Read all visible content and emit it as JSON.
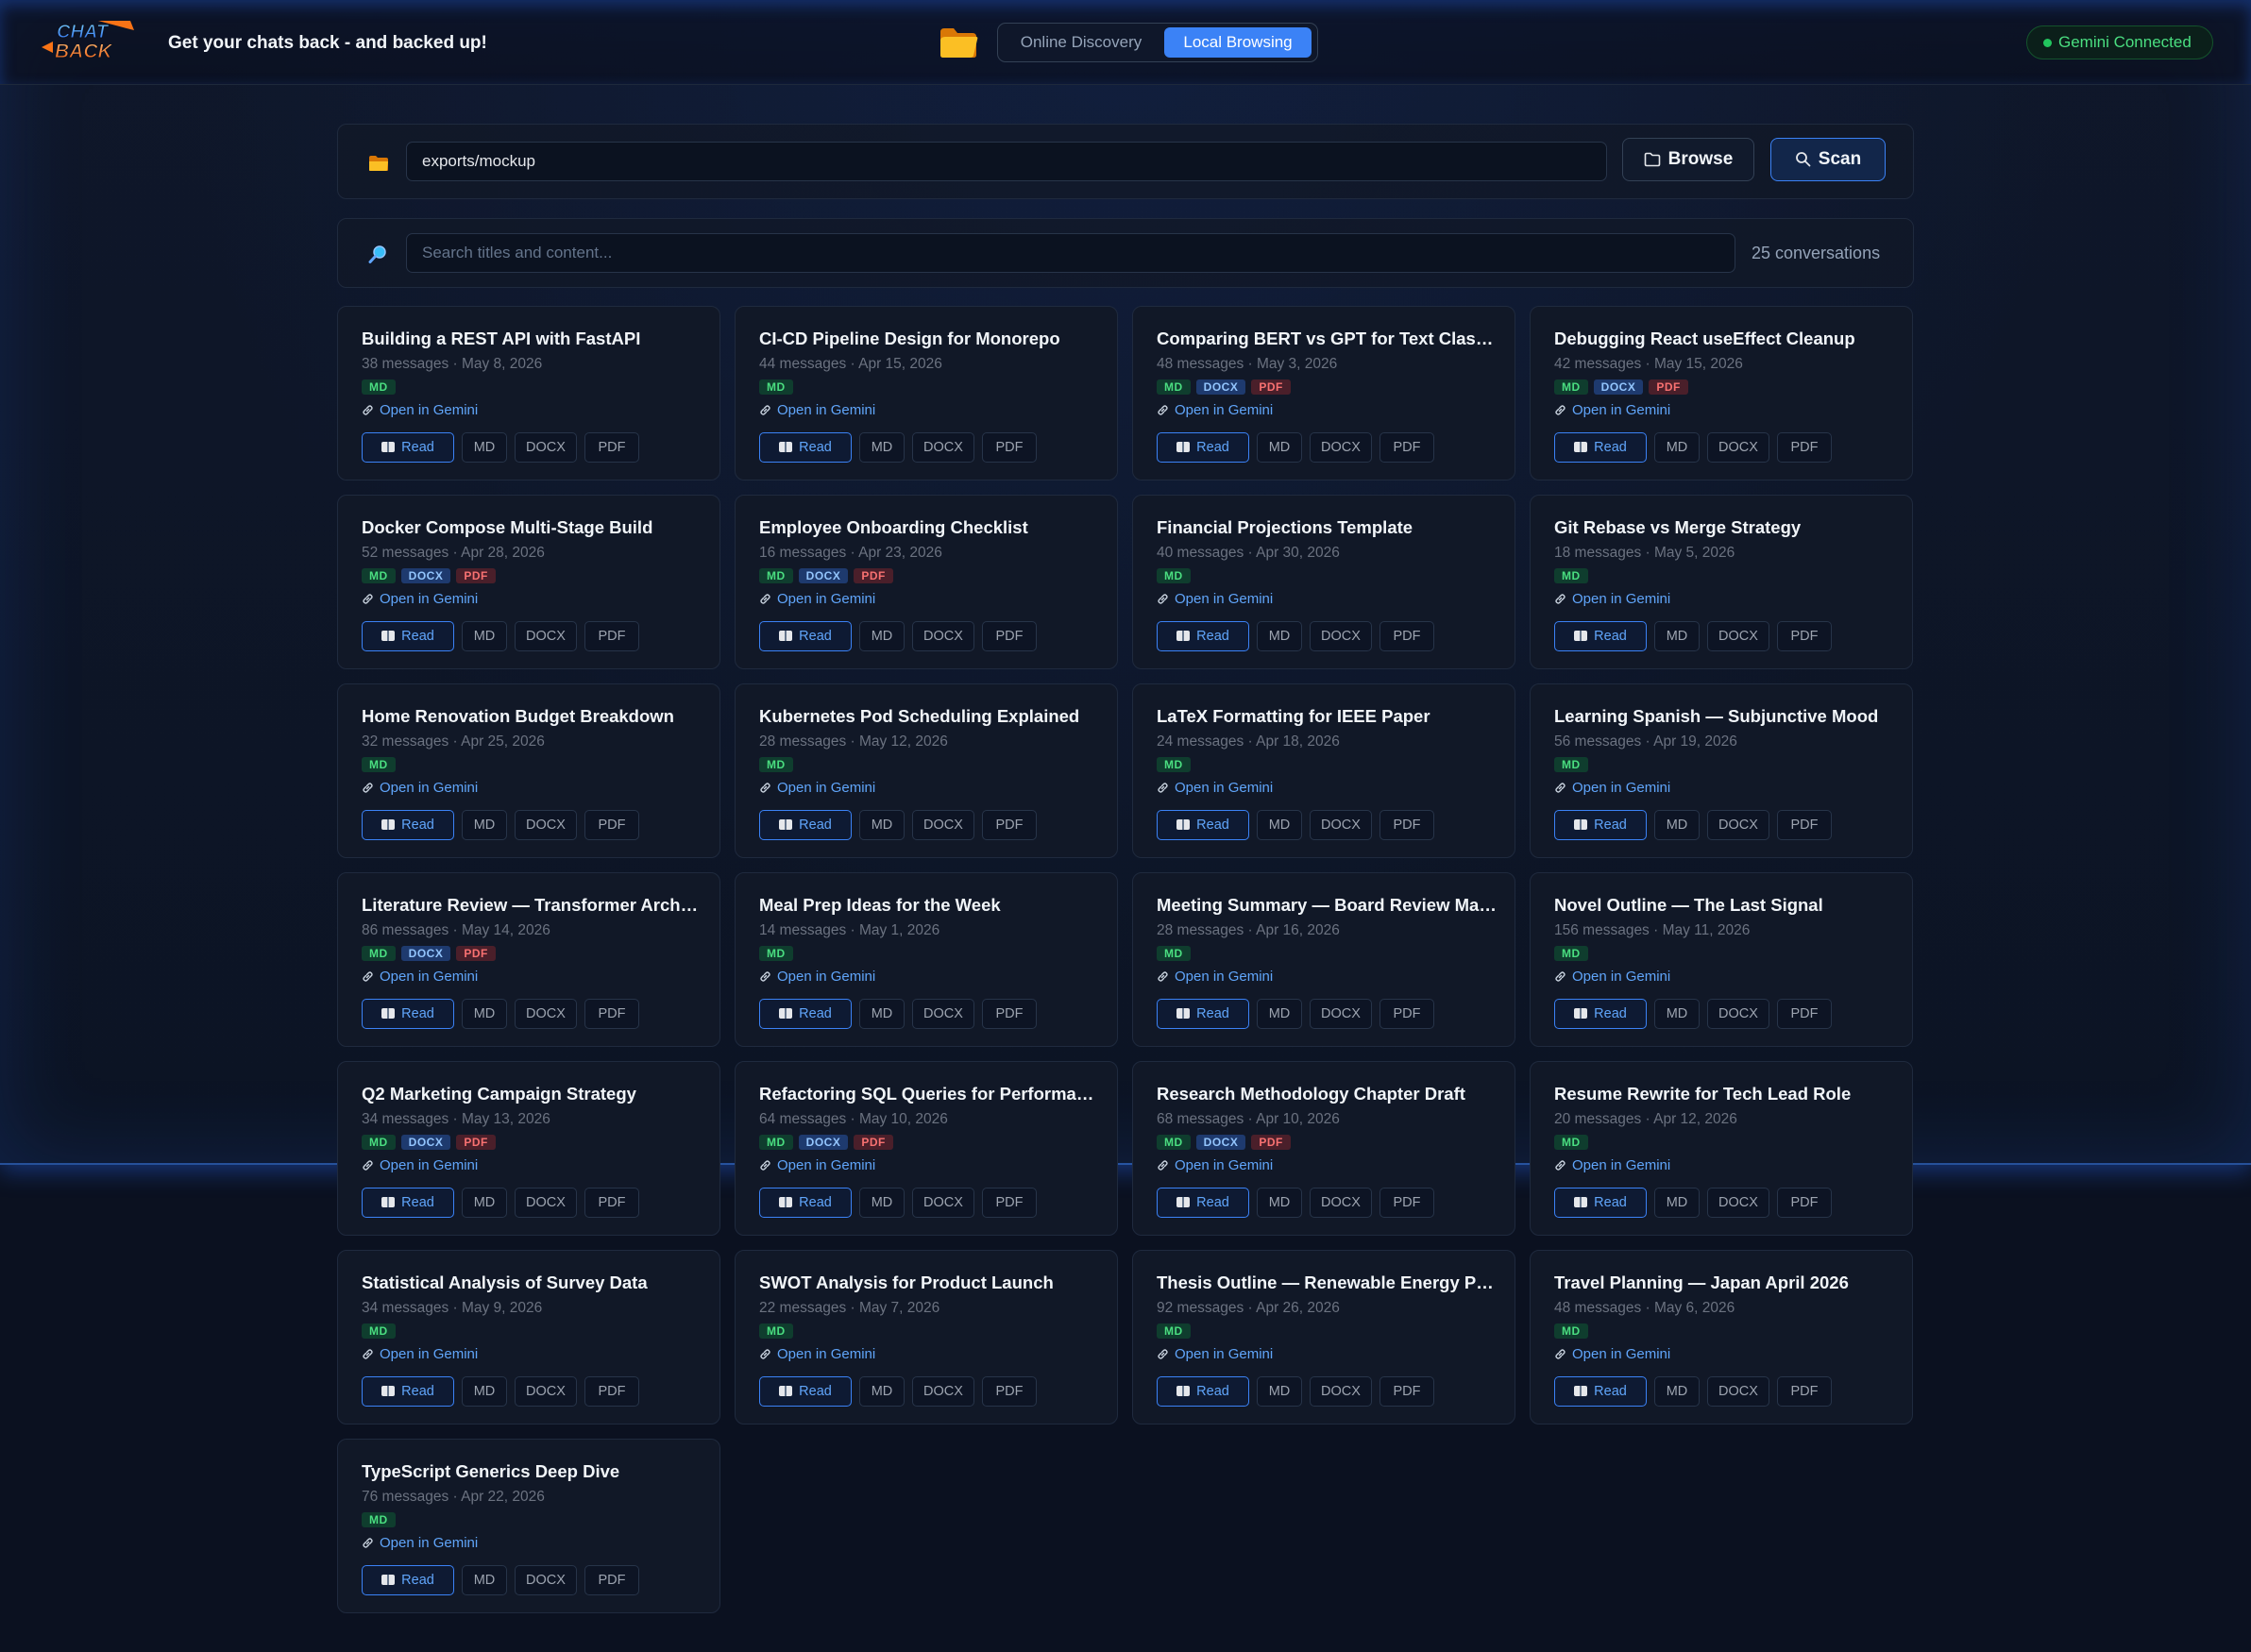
{
  "header": {
    "tagline": "Get your chats back - and backed up!",
    "logo_text": "CHAT BACK",
    "mode_online": "Online Discovery",
    "mode_local": "Local Browsing",
    "status": "Gemini Connected"
  },
  "path": {
    "value": "exports/mockup",
    "browse_label": "Browse",
    "scan_label": "Scan"
  },
  "search": {
    "placeholder": "Search titles and content...",
    "count": "25 conversations"
  },
  "labels": {
    "open": "Open in Gemini",
    "read": "Read",
    "md": "MD",
    "docx": "DOCX",
    "pdf": "PDF"
  },
  "colors": {
    "accent": "#3b82f6",
    "status_green": "#22c55e",
    "badge_md": "#4ade80",
    "badge_docx": "#93c5fd",
    "badge_pdf": "#f87171"
  },
  "conversations": [
    {
      "title": "Building a REST API with FastAPI",
      "meta": "38 messages · May 8, 2026",
      "formats": [
        "MD"
      ]
    },
    {
      "title": "CI-CD Pipeline Design for Monorepo",
      "meta": "44 messages · Apr 15, 2026",
      "formats": [
        "MD"
      ]
    },
    {
      "title": "Comparing BERT vs GPT for Text Classif...",
      "meta": "48 messages · May 3, 2026",
      "formats": [
        "MD",
        "DOCX",
        "PDF"
      ]
    },
    {
      "title": "Debugging React useEffect Cleanup",
      "meta": "42 messages · May 15, 2026",
      "formats": [
        "MD",
        "DOCX",
        "PDF"
      ]
    },
    {
      "title": "Docker Compose Multi-Stage Build",
      "meta": "52 messages · Apr 28, 2026",
      "formats": [
        "MD",
        "DOCX",
        "PDF"
      ]
    },
    {
      "title": "Employee Onboarding Checklist",
      "meta": "16 messages · Apr 23, 2026",
      "formats": [
        "MD",
        "DOCX",
        "PDF"
      ]
    },
    {
      "title": "Financial Projections Template",
      "meta": "40 messages · Apr 30, 2026",
      "formats": [
        "MD"
      ]
    },
    {
      "title": "Git Rebase vs Merge Strategy",
      "meta": "18 messages · May 5, 2026",
      "formats": [
        "MD"
      ]
    },
    {
      "title": "Home Renovation Budget Breakdown",
      "meta": "32 messages · Apr 25, 2026",
      "formats": [
        "MD"
      ]
    },
    {
      "title": "Kubernetes Pod Scheduling Explained",
      "meta": "28 messages · May 12, 2026",
      "formats": [
        "MD"
      ]
    },
    {
      "title": "LaTeX Formatting for IEEE Paper",
      "meta": "24 messages · Apr 18, 2026",
      "formats": [
        "MD"
      ]
    },
    {
      "title": "Learning Spanish — Subjunctive Mood",
      "meta": "56 messages · Apr 19, 2026",
      "formats": [
        "MD"
      ]
    },
    {
      "title": "Literature Review — Transformer Archit...",
      "meta": "86 messages · May 14, 2026",
      "formats": [
        "MD",
        "DOCX",
        "PDF"
      ]
    },
    {
      "title": "Meal Prep Ideas for the Week",
      "meta": "14 messages · May 1, 2026",
      "formats": [
        "MD"
      ]
    },
    {
      "title": "Meeting Summary — Board Review March",
      "meta": "28 messages · Apr 16, 2026",
      "formats": [
        "MD"
      ]
    },
    {
      "title": "Novel Outline — The Last Signal",
      "meta": "156 messages · May 11, 2026",
      "formats": [
        "MD"
      ]
    },
    {
      "title": "Q2 Marketing Campaign Strategy",
      "meta": "34 messages · May 13, 2026",
      "formats": [
        "MD",
        "DOCX",
        "PDF"
      ]
    },
    {
      "title": "Refactoring SQL Queries for Performance",
      "meta": "64 messages · May 10, 2026",
      "formats": [
        "MD",
        "DOCX",
        "PDF"
      ]
    },
    {
      "title": "Research Methodology Chapter Draft",
      "meta": "68 messages · Apr 10, 2026",
      "formats": [
        "MD",
        "DOCX",
        "PDF"
      ]
    },
    {
      "title": "Resume Rewrite for Tech Lead Role",
      "meta": "20 messages · Apr 12, 2026",
      "formats": [
        "MD"
      ]
    },
    {
      "title": "Statistical Analysis of Survey Data",
      "meta": "34 messages · May 9, 2026",
      "formats": [
        "MD"
      ]
    },
    {
      "title": "SWOT Analysis for Product Launch",
      "meta": "22 messages · May 7, 2026",
      "formats": [
        "MD"
      ]
    },
    {
      "title": "Thesis Outline — Renewable Energy Poli...",
      "meta": "92 messages · Apr 26, 2026",
      "formats": [
        "MD"
      ]
    },
    {
      "title": "Travel Planning — Japan April 2026",
      "meta": "48 messages · May 6, 2026",
      "formats": [
        "MD"
      ]
    },
    {
      "title": "TypeScript Generics Deep Dive",
      "meta": "76 messages · Apr 22, 2026",
      "formats": [
        "MD"
      ]
    }
  ]
}
